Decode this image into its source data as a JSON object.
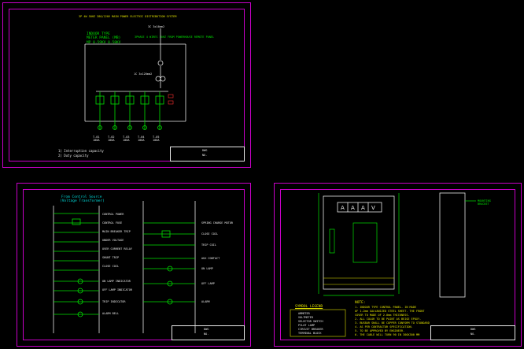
{
  "sheet1": {
    "title": "3P 4W 50HZ 380/220V MAIN POWER ELECTRIC DISTRIBUTION SYSTEM",
    "panel": [
      "INDOOR TYPE",
      "METER PANEL (MB)",
      "MP 0.59KV 0.58KV"
    ],
    "incoming": "3C 3x16mm2",
    "supply_note": "3PHASE 4 WIRES 50HZ FROM POWERHOUSE REMOTE PANEL",
    "cable": "1C 3x120mm2",
    "notes": [
      "1) Interruption capacity",
      "2) Duty capacity"
    ],
    "outgoing": [
      {
        "l1": "T-01",
        "l2": "100A"
      },
      {
        "l1": "T-02",
        "l2": "100A"
      },
      {
        "l1": "T-03",
        "l2": "100A"
      },
      {
        "l1": "T-04",
        "l2": "100A"
      },
      {
        "l1": "T-05",
        "l2": "100A"
      }
    ],
    "tb": [
      "DWG",
      "NO."
    ]
  },
  "sheet2": {
    "title": [
      "From Control Source",
      "(Voltage Transformer)"
    ],
    "labels": [
      "CONTROL POWER",
      "CONTROL FUSE",
      "MAIN BREAKER TRIP",
      "UNDER VOLTAGE",
      "OVER CURRENT RELAY",
      "SHUNT TRIP",
      "CLOSE COIL",
      "ON LAMP INDICATOR",
      "OFF LAMP INDICATOR",
      "TRIP INDICATOR",
      "ALARM BELL"
    ],
    "right_labels": [
      "SPRING CHARGE MOTOR",
      "CLOSE COIL",
      "TRIP COIL",
      "AUX CONTACT",
      "ON LAMP",
      "OFF LAMP",
      "ALARM"
    ],
    "tb": [
      "DWG",
      "NO."
    ]
  },
  "sheet3": {
    "meters": [
      "A",
      "A",
      "A",
      "V"
    ],
    "legend_title": "SYMBOL LEGEND",
    "legend": [
      "AMMETER",
      "VOLTMETER",
      "SELECTOR SWITCH",
      "PILOT LAMP",
      "CIRCUIT BREAKER",
      "TERMINAL BLOCK"
    ],
    "note_title": "NOTE:",
    "notes": [
      "1. INDOOR TYPE CONTROL PANEL. IN MADE",
      "   OF 1.2mm GALVANIZED STEEL SHEET. THE FRONT",
      "   COVER TO MADE OF 2.0mm THICKNESS.",
      "2. ALL COLOR TO BE PAINT AS BEIGE EPOXY.",
      "3. BUSBAR SHALL BE COPPER CONFORM TO STANDARD",
      "4. AS PER CONTRACTOR SPECIFICATION.",
      "5. TO BE APPROVED BY ENGINEER.",
      "6. THE CABLE WILL TURN 90 IN 300X300 MM"
    ],
    "side_label": [
      "MOUNTING",
      "BRACKET"
    ],
    "tb": [
      "DWG",
      "NO."
    ]
  }
}
